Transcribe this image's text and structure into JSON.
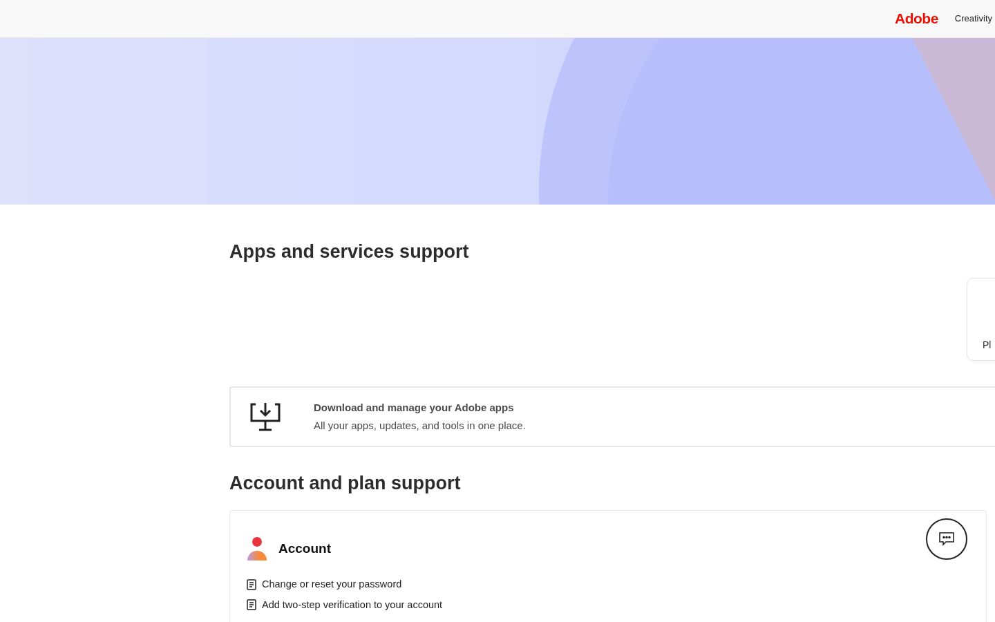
{
  "header": {
    "logo": "Adobe",
    "nav_item": "Creativity"
  },
  "apps_section": {
    "title": "Apps and services support",
    "side_card": {
      "label": "Pl"
    },
    "download_card": {
      "title": "Download and manage your Adobe apps",
      "subtitle": "All your apps, updates, and tools in one place."
    }
  },
  "account_section": {
    "title": "Account and plan support",
    "account_card": {
      "title": "Account",
      "links": [
        "Change or reset your password",
        "Add two-step verification to your account"
      ]
    }
  }
}
